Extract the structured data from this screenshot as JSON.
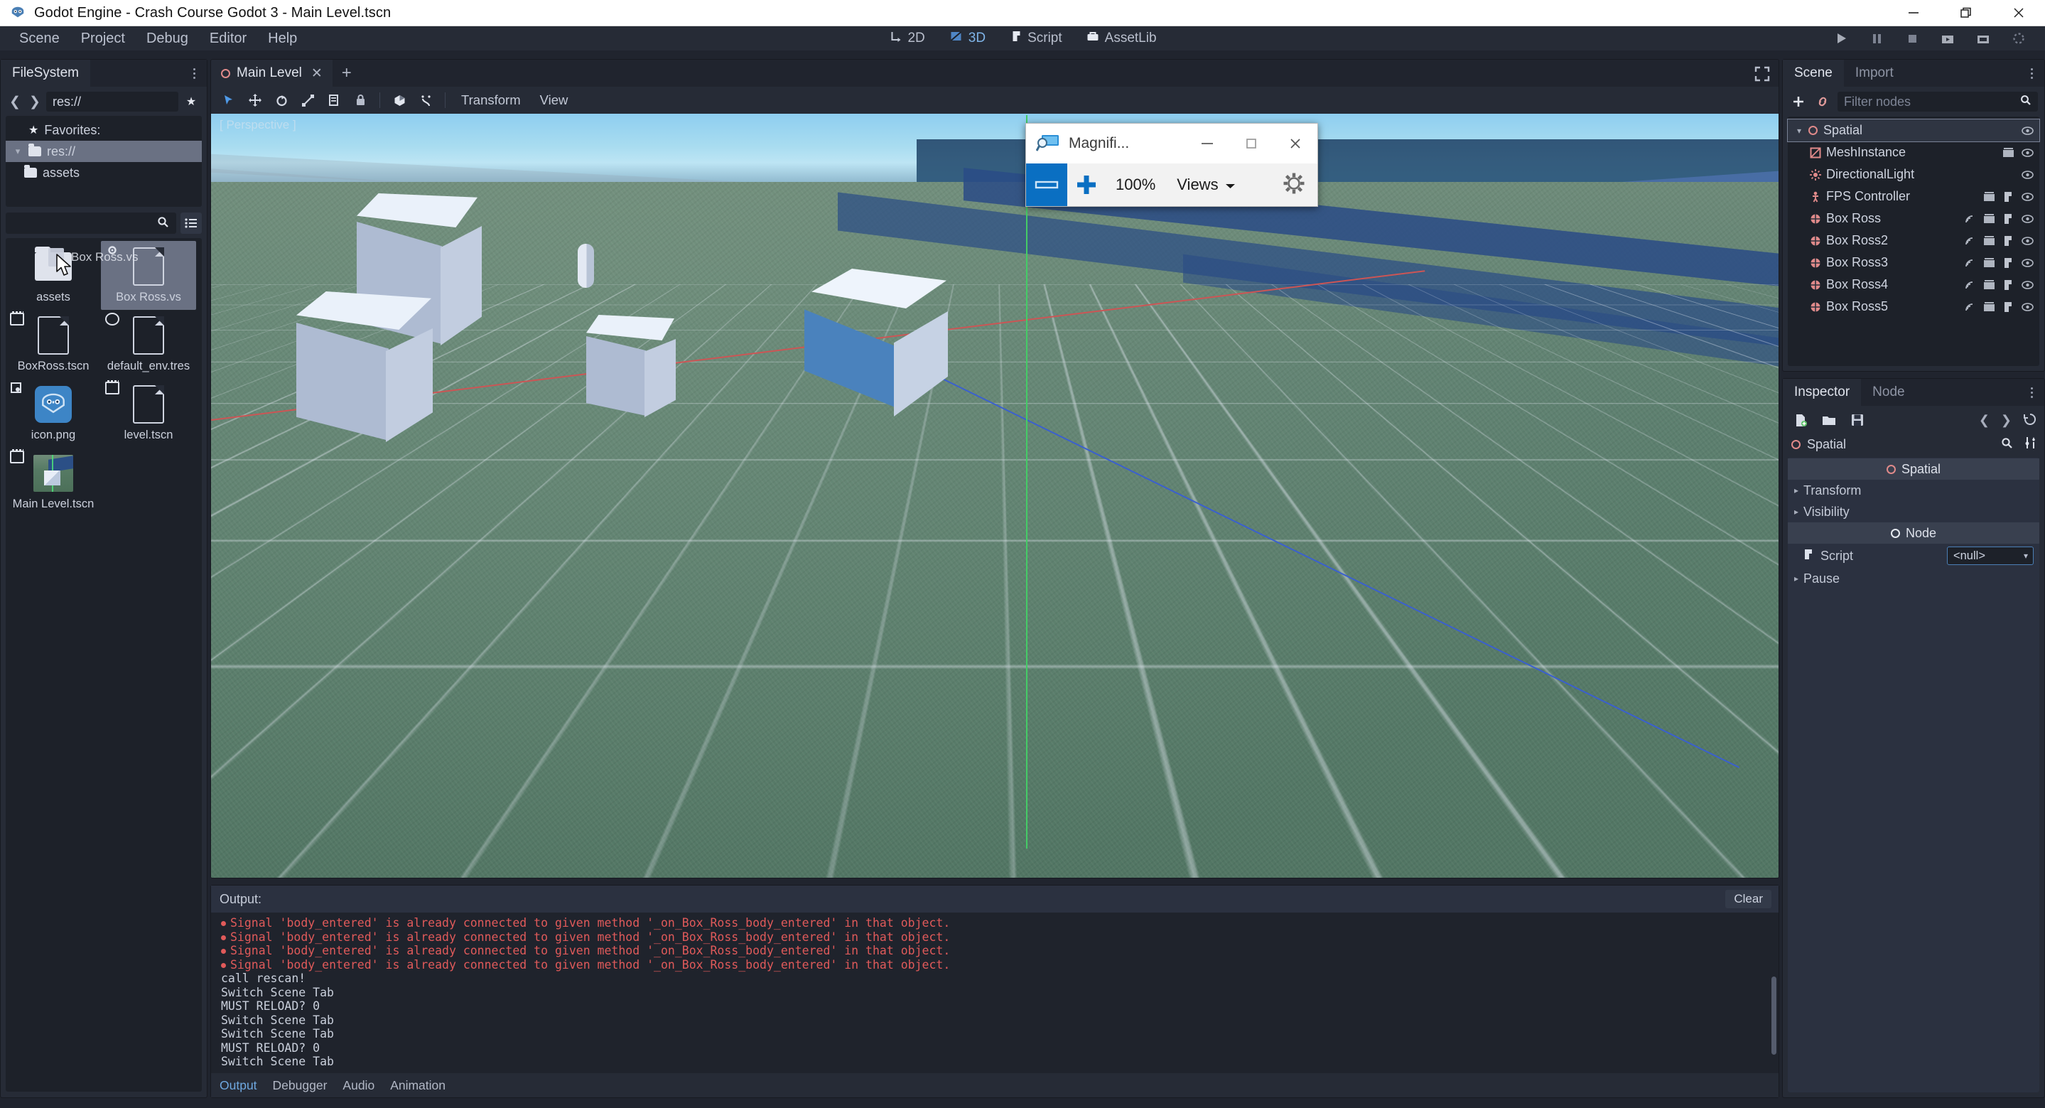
{
  "os_window": {
    "title": "Godot Engine - Crash Course Godot 3 - Main Level.tscn",
    "minimize": "minimize-icon",
    "maximize": "restore-icon",
    "close": "close-icon"
  },
  "menubar": {
    "items": [
      "Scene",
      "Project",
      "Debug",
      "Editor",
      "Help"
    ],
    "modes": [
      {
        "label": "2D",
        "icon": "2d-icon",
        "active": false
      },
      {
        "label": "3D",
        "icon": "3d-icon",
        "active": true
      },
      {
        "label": "Script",
        "icon": "script-icon",
        "active": false
      },
      {
        "label": "AssetLib",
        "icon": "assetlib-icon",
        "active": false
      }
    ],
    "play_controls": [
      "play-icon",
      "pause-icon",
      "stop-icon",
      "play-scene-icon",
      "play-custom-scene-icon",
      "spinner-icon"
    ]
  },
  "filesystem": {
    "tab": "FileSystem",
    "path_value": "res://",
    "back": "chevron-left-icon",
    "forward": "chevron-right-icon",
    "favorite": "star-icon",
    "tree": [
      {
        "label": "Favorites:",
        "icon": "star-icon",
        "indent": 0,
        "selected": false,
        "twisty": ""
      },
      {
        "label": "res://",
        "icon": "folder-icon",
        "indent": 0,
        "selected": true,
        "twisty": "v"
      },
      {
        "label": "assets",
        "icon": "folder-icon",
        "indent": 1,
        "selected": false,
        "twisty": ""
      }
    ],
    "search_placeholder": "",
    "files": [
      {
        "name": "assets",
        "type": "folder",
        "badge": "",
        "selected": false
      },
      {
        "name": "Box Ross.vs",
        "type": "document",
        "badge": "gear",
        "selected": true
      },
      {
        "name": "BoxRoss.tscn",
        "type": "document",
        "badge": "film",
        "selected": false
      },
      {
        "name": "default_env.tres",
        "type": "document",
        "badge": "globe",
        "selected": false
      },
      {
        "name": "icon.png",
        "type": "image",
        "badge": "image",
        "selected": false
      },
      {
        "name": "level.tscn",
        "type": "document",
        "badge": "film",
        "selected": false
      },
      {
        "name": "Main Level.tscn",
        "type": "scene-thumb",
        "badge": "film",
        "selected": false
      }
    ],
    "drag_label": "Box Ross.vs"
  },
  "viewport": {
    "scene_tab": "Main Level",
    "close_tab": "close-icon",
    "add_tab": "plus-icon",
    "expand": "expand-icon",
    "tools": [
      "select-icon",
      "move-icon",
      "rotate-icon",
      "scale-icon",
      "list-icon",
      "lock-icon",
      "mode-icon",
      "snap-icon"
    ],
    "menus": [
      "Transform",
      "View"
    ],
    "perspective_label": "[ Perspective ]"
  },
  "output": {
    "header": "Output:",
    "clear_label": "Clear",
    "lines": [
      {
        "text": "Signal 'body_entered' is already connected to given method '_on_Box_Ross_body_entered' in that object.",
        "error": true
      },
      {
        "text": "Signal 'body_entered' is already connected to given method '_on_Box_Ross_body_entered' in that object.",
        "error": true
      },
      {
        "text": "Signal 'body_entered' is already connected to given method '_on_Box_Ross_body_entered' in that object.",
        "error": true
      },
      {
        "text": "Signal 'body_entered' is already connected to given method '_on_Box_Ross_body_entered' in that object.",
        "error": true
      },
      {
        "text": "call rescan!",
        "error": false
      },
      {
        "text": "Switch Scene Tab",
        "error": false
      },
      {
        "text": "MUST RELOAD? 0",
        "error": false
      },
      {
        "text": "Switch Scene Tab",
        "error": false
      },
      {
        "text": "Switch Scene Tab",
        "error": false
      },
      {
        "text": "MUST RELOAD? 0",
        "error": false
      },
      {
        "text": "Switch Scene Tab",
        "error": false
      }
    ],
    "tabs": [
      {
        "label": "Output",
        "active": true
      },
      {
        "label": "Debugger",
        "active": false
      },
      {
        "label": "Audio",
        "active": false
      },
      {
        "label": "Animation",
        "active": false
      }
    ]
  },
  "scene_dock": {
    "tabs": [
      {
        "label": "Scene",
        "active": true
      },
      {
        "label": "Import",
        "active": false
      }
    ],
    "add_node": "plus-icon",
    "instance_node": "link-icon",
    "filter_placeholder": "Filter nodes",
    "search_icon": "search-icon",
    "nodes": [
      {
        "label": "Spatial",
        "icon": "spatial-icon",
        "indent": 0,
        "selected": true,
        "twisty": "v",
        "icons": [
          "visibility-icon"
        ]
      },
      {
        "label": "MeshInstance",
        "icon": "meshinstance-icon",
        "indent": 1,
        "selected": false,
        "twisty": "",
        "icons": [
          "film-icon",
          "visibility-icon"
        ]
      },
      {
        "label": "DirectionalLight",
        "icon": "light-icon",
        "indent": 1,
        "selected": false,
        "twisty": "",
        "icons": [
          "visibility-icon"
        ]
      },
      {
        "label": "FPS Controller",
        "icon": "kinematic-icon",
        "indent": 1,
        "selected": false,
        "twisty": "",
        "icons": [
          "film-icon",
          "script-icon",
          "visibility-icon"
        ]
      },
      {
        "label": "Box Ross",
        "icon": "area-icon",
        "indent": 1,
        "selected": false,
        "twisty": "",
        "icons": [
          "signal-icon",
          "film-icon",
          "script-icon",
          "visibility-icon"
        ]
      },
      {
        "label": "Box Ross2",
        "icon": "area-icon",
        "indent": 1,
        "selected": false,
        "twisty": "",
        "icons": [
          "signal-icon",
          "film-icon",
          "script-icon",
          "visibility-icon"
        ]
      },
      {
        "label": "Box Ross3",
        "icon": "area-icon",
        "indent": 1,
        "selected": false,
        "twisty": "",
        "icons": [
          "signal-icon",
          "film-icon",
          "script-icon",
          "visibility-icon"
        ]
      },
      {
        "label": "Box Ross4",
        "icon": "area-icon",
        "indent": 1,
        "selected": false,
        "twisty": "",
        "icons": [
          "signal-icon",
          "film-icon",
          "script-icon",
          "visibility-icon"
        ]
      },
      {
        "label": "Box Ross5",
        "icon": "area-icon",
        "indent": 1,
        "selected": false,
        "twisty": "",
        "icons": [
          "signal-icon",
          "film-icon",
          "script-icon",
          "visibility-icon"
        ]
      }
    ]
  },
  "inspector": {
    "tabs": [
      {
        "label": "Inspector",
        "active": true
      },
      {
        "label": "Node",
        "active": false
      }
    ],
    "toolbar": [
      "new-resource-icon",
      "open-resource-icon",
      "save-resource-icon"
    ],
    "nav": [
      "chevron-left-icon",
      "chevron-right-icon",
      "history-icon"
    ],
    "object_name": "Spatial",
    "search_icon": "search-icon",
    "tools_icon": "tools-icon",
    "sections": [
      {
        "kind": "header",
        "label": "Spatial",
        "ring": "red"
      },
      {
        "kind": "row",
        "label": "Transform"
      },
      {
        "kind": "row",
        "label": "Visibility"
      },
      {
        "kind": "header",
        "label": "Node",
        "ring": "white"
      },
      {
        "kind": "script",
        "label": "Script",
        "value": "<null>"
      },
      {
        "kind": "row",
        "label": "Pause"
      }
    ]
  },
  "magnifier": {
    "title": "Magnifi...",
    "app_icon": "magnifier-icon",
    "minimize": "minimize-icon",
    "maximize": "maximize-icon",
    "close": "close-icon",
    "zoom_out": "minus-icon",
    "zoom_in": "plus-icon",
    "zoom_level": "100%",
    "views_label": "Views",
    "views_caret": "chevron-down-icon",
    "settings": "gear-icon"
  },
  "colors": {
    "accent": "#6fa8e0",
    "error": "#e05a5a",
    "panel": "#262b36",
    "panel_dark": "#1d2129",
    "magnifier_blue": "#0a6fc2",
    "node_red": "#e08a8a"
  }
}
